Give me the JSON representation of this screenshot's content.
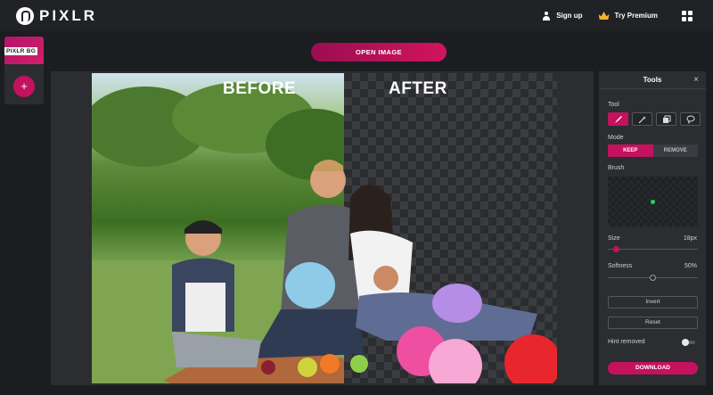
{
  "app": {
    "logo_text": "PIXLR"
  },
  "header": {
    "signup_label": "Sign up",
    "premium_label": "Try Premium"
  },
  "left_panel": {
    "tag": "PIXLR BG",
    "add_symbol": "+"
  },
  "actions": {
    "open_image_label": "OPEN IMAGE"
  },
  "canvas": {
    "before_label": "BEFORE",
    "after_label": "AFTER"
  },
  "tools": {
    "title": "Tools",
    "close_symbol": "×",
    "tool_section": "Tool",
    "tool_icons": [
      "brush-icon",
      "magic-wand-icon",
      "fill-icon",
      "lasso-icon"
    ],
    "mode_section": "Mode",
    "modes": [
      "KEEP",
      "REMOVE"
    ],
    "active_mode": "KEEP",
    "brush_section": "Brush",
    "size_label": "Size",
    "size_value": "18px",
    "size_fraction": 0.06,
    "softness_label": "Softness",
    "softness_value": "50%",
    "softness_fraction": 0.5,
    "invert_label": "Invert",
    "reset_label": "Reset",
    "hint_label": "Hint removed",
    "hint_on": false,
    "download_label": "DOWNLOAD"
  },
  "colors": {
    "accent": "#c4125f",
    "background": "#1b1d21",
    "panel": "#2b2d31"
  }
}
